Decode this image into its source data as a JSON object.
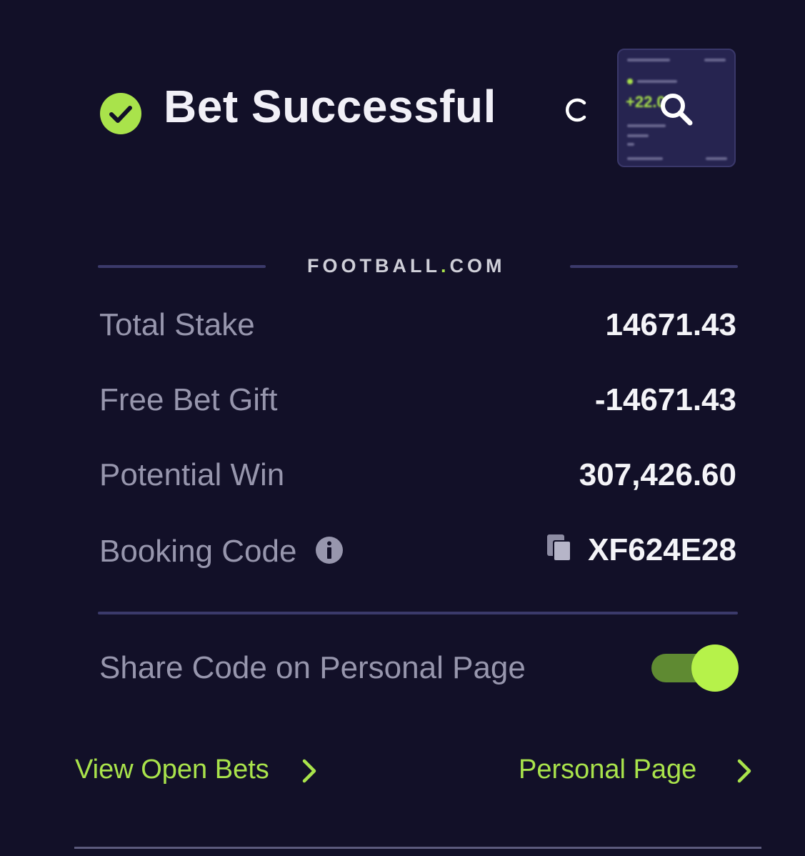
{
  "header": {
    "title": "Bet Successful",
    "status_icon": "check-circle-icon",
    "refresh_icon": "refresh-icon",
    "thumbnail": {
      "preview_label": "+22.0",
      "zoom_icon": "zoom-icon"
    }
  },
  "brand": {
    "left": "FOOTBALL",
    "dot": ".",
    "right": "COM"
  },
  "summary": {
    "total_stake": {
      "label": "Total Stake",
      "value": "14671.43"
    },
    "free_bet_gift": {
      "label": "Free Bet Gift",
      "value": "-14671.43"
    },
    "potential_win": {
      "label": "Potential Win",
      "value": "307,426.60"
    },
    "booking_code": {
      "label": "Booking Code",
      "value": "XF624E28",
      "info_icon": "info-icon",
      "copy_icon": "copy-icon"
    }
  },
  "share": {
    "label": "Share Code on Personal Page",
    "enabled": true
  },
  "links": {
    "view_open_bets": "View Open Bets",
    "personal_page": "Personal Page"
  },
  "colors": {
    "background": "#121028",
    "accent": "#a9e34b",
    "divider": "#3b3a6b",
    "label": "#9796ad",
    "value": "#f4f4f8"
  }
}
